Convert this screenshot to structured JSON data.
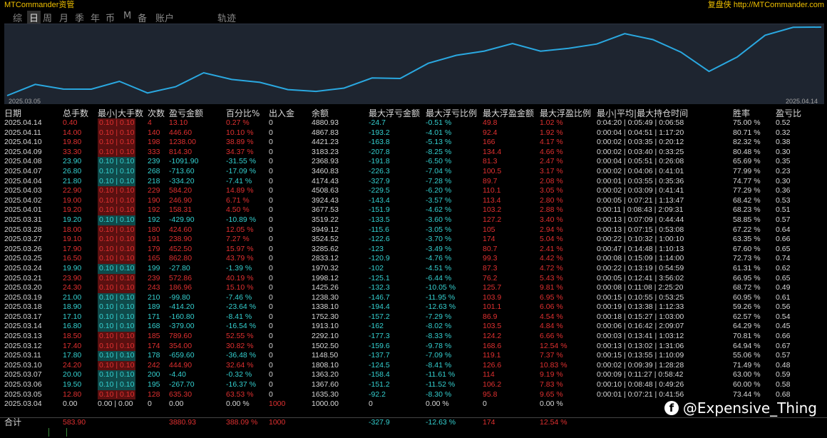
{
  "app": {
    "title": "MTCommander资管",
    "site": "复盘侠 http://MTCommander.com"
  },
  "tabs": [
    "综",
    "日",
    "周",
    "月",
    "季",
    "年",
    "币",
    "M",
    "备",
    "账户",
    "轨迹"
  ],
  "active_tab": "日",
  "equity_chart": {
    "start_date": "2025.03.05",
    "end_date": "2025.04.14",
    "line_color": "#2aa8e0",
    "background": "#1e2530",
    "balance_series": [
      1000.0,
      1635.3,
      1367.6,
      1363.2,
      1808.1,
      1148.5,
      1502.5,
      2292.1,
      1913.1,
      1752.3,
      1338.1,
      1238.3,
      1425.26,
      1998.12,
      1970.32,
      2833.12,
      3285.62,
      3524.52,
      3949.12,
      3519.22,
      3677.53,
      3924.43,
      4508.63,
      4174.43,
      3460.83,
      2368.93,
      3183.23,
      4421.23,
      4867.83,
      4880.93
    ]
  },
  "headers": [
    "日期",
    "总手数",
    "最小|大手数",
    "次数",
    "盈亏金额",
    "百分比%",
    "出入金",
    "余额",
    "最大浮亏金额",
    "最大浮亏比例",
    "最大浮盈金额",
    "最大浮盈比例",
    "最小|平均|最大持仓时间",
    "胜率",
    "盈亏比"
  ],
  "rows": [
    {
      "date": "2025.04.14",
      "lots": "0.40",
      "minmax": "0.10 | 0.10",
      "count": "4",
      "pnl": "13.10",
      "pct": "0.27 %",
      "io": "0",
      "bal": "4880.93",
      "fl": "-24.7",
      "flp": "-0.51 %",
      "fp": "49.8",
      "fpp": "1.02 %",
      "hold": "0:04:20 | 0:05:49 | 0:06:58",
      "win": "75.00 %",
      "pr": "0.52",
      "s": "p"
    },
    {
      "date": "2025.04.11",
      "lots": "14.00",
      "minmax": "0.10 | 0.10",
      "count": "140",
      "pnl": "446.60",
      "pct": "10.10 %",
      "io": "0",
      "bal": "4867.83",
      "fl": "-193.2",
      "flp": "-4.01 %",
      "fp": "92.4",
      "fpp": "1.92 %",
      "hold": "0:00:04 | 0:04:51 | 1:17:20",
      "win": "80.71 %",
      "pr": "0.32",
      "s": "p"
    },
    {
      "date": "2025.04.10",
      "lots": "19.80",
      "minmax": "0.10 | 0.10",
      "count": "198",
      "pnl": "1238.00",
      "pct": "38.89 %",
      "io": "0",
      "bal": "4421.23",
      "fl": "-163.8",
      "flp": "-5.13 %",
      "fp": "166",
      "fpp": "4.17 %",
      "hold": "0:00:02 | 0:03:35 | 0:20:12",
      "win": "82.32 %",
      "pr": "0.38",
      "s": "p"
    },
    {
      "date": "2025.04.09",
      "lots": "33.30",
      "minmax": "0.10 | 0.10",
      "count": "333",
      "pnl": "814.30",
      "pct": "34.37 %",
      "io": "0",
      "bal": "3183.23",
      "fl": "-207.8",
      "flp": "-8.25 %",
      "fp": "134.4",
      "fpp": "4.66 %",
      "hold": "0:00:02 | 0:03:40 | 0:33:25",
      "win": "80.48 %",
      "pr": "0.30",
      "s": "p"
    },
    {
      "date": "2025.04.08",
      "lots": "23.90",
      "minmax": "0.10 | 0.10",
      "count": "239",
      "pnl": "-1091.90",
      "pct": "-31.55 %",
      "io": "0",
      "bal": "2368.93",
      "fl": "-191.8",
      "flp": "-6.50 %",
      "fp": "81.3",
      "fpp": "2.47 %",
      "hold": "0:00:04 | 0:05:51 | 0:26:08",
      "win": "65.69 %",
      "pr": "0.35",
      "s": "n"
    },
    {
      "date": "2025.04.07",
      "lots": "26.80",
      "minmax": "0.10 | 0.10",
      "count": "268",
      "pnl": "-713.60",
      "pct": "-17.09 %",
      "io": "0",
      "bal": "3460.83",
      "fl": "-226.3",
      "flp": "-7.04 %",
      "fp": "100.5",
      "fpp": "3.17 %",
      "hold": "0:00:02 | 0:04:06 | 0:41:01",
      "win": "77.99 %",
      "pr": "0.23",
      "s": "n"
    },
    {
      "date": "2025.04.04",
      "lots": "21.80",
      "minmax": "0.10 | 0.10",
      "count": "218",
      "pnl": "-334.20",
      "pct": "-7.41 %",
      "io": "0",
      "bal": "4174.43",
      "fl": "-327.9",
      "flp": "-7.28 %",
      "fp": "89.7",
      "fpp": "2.08 %",
      "hold": "0:00:01 | 0:03:55 | 0:35:36",
      "win": "74.77 %",
      "pr": "0.30",
      "s": "n"
    },
    {
      "date": "2025.04.03",
      "lots": "22.90",
      "minmax": "0.10 | 0.10",
      "count": "229",
      "pnl": "584.20",
      "pct": "14.89 %",
      "io": "0",
      "bal": "4508.63",
      "fl": "-229.5",
      "flp": "-6.20 %",
      "fp": "110.1",
      "fpp": "3.05 %",
      "hold": "0:00:02 | 0:03:09 | 0:41:41",
      "win": "77.29 %",
      "pr": "0.36",
      "s": "p"
    },
    {
      "date": "2025.04.02",
      "lots": "19.00",
      "minmax": "0.10 | 0.10",
      "count": "190",
      "pnl": "246.90",
      "pct": "6.71 %",
      "io": "0",
      "bal": "3924.43",
      "fl": "-143.4",
      "flp": "-3.57 %",
      "fp": "113.4",
      "fpp": "2.80 %",
      "hold": "0:00:05 | 0:07:21 | 1:13:47",
      "win": "68.42 %",
      "pr": "0.53",
      "s": "p"
    },
    {
      "date": "2025.04.01",
      "lots": "19.20",
      "minmax": "0.10 | 0.10",
      "count": "192",
      "pnl": "158.31",
      "pct": "4.50 %",
      "io": "0",
      "bal": "3677.53",
      "fl": "-151.9",
      "flp": "-4.62 %",
      "fp": "103.2",
      "fpp": "2.88 %",
      "hold": "0:00:11 | 0:08:43 | 2:09:31",
      "win": "68.23 %",
      "pr": "0.51",
      "s": "p"
    },
    {
      "date": "2025.03.31",
      "lots": "19.20",
      "minmax": "0.10 | 0.10",
      "count": "192",
      "pnl": "-429.90",
      "pct": "-10.89 %",
      "io": "0",
      "bal": "3519.22",
      "fl": "-133.5",
      "flp": "-3.60 %",
      "fp": "127.2",
      "fpp": "3.40 %",
      "hold": "0:00:13 | 0:07:09 | 0:44:44",
      "win": "58.85 %",
      "pr": "0.57",
      "s": "n"
    },
    {
      "date": "2025.03.28",
      "lots": "18.00",
      "minmax": "0.10 | 0.10",
      "count": "180",
      "pnl": "424.60",
      "pct": "12.05 %",
      "io": "0",
      "bal": "3949.12",
      "fl": "-115.6",
      "flp": "-3.05 %",
      "fp": "105",
      "fpp": "2.94 %",
      "hold": "0:00:13 | 0:07:15 | 0:53:08",
      "win": "67.22 %",
      "pr": "0.64",
      "s": "p"
    },
    {
      "date": "2025.03.27",
      "lots": "19.10",
      "minmax": "0.10 | 0.10",
      "count": "191",
      "pnl": "238.90",
      "pct": "7.27 %",
      "io": "0",
      "bal": "3524.52",
      "fl": "-122.6",
      "flp": "-3.70 %",
      "fp": "174",
      "fpp": "5.04 %",
      "hold": "0:00:22 | 0:10:32 | 1:00:10",
      "win": "63.35 %",
      "pr": "0.66",
      "s": "p"
    },
    {
      "date": "2025.03.26",
      "lots": "17.90",
      "minmax": "0.10 | 0.10",
      "count": "179",
      "pnl": "452.50",
      "pct": "15.97 %",
      "io": "0",
      "bal": "3285.62",
      "fl": "-123",
      "flp": "-3.49 %",
      "fp": "80.7",
      "fpp": "2.41 %",
      "hold": "0:00:47 | 0:14:48 | 1:10:13",
      "win": "67.60 %",
      "pr": "0.65",
      "s": "p"
    },
    {
      "date": "2025.03.25",
      "lots": "16.50",
      "minmax": "0.10 | 0.10",
      "count": "165",
      "pnl": "862.80",
      "pct": "43.79 %",
      "io": "0",
      "bal": "2833.12",
      "fl": "-120.9",
      "flp": "-4.76 %",
      "fp": "99.3",
      "fpp": "4.42 %",
      "hold": "0:00:08 | 0:15:09 | 1:14:00",
      "win": "72.73 %",
      "pr": "0.74",
      "s": "p"
    },
    {
      "date": "2025.03.24",
      "lots": "19.90",
      "minmax": "0.10 | 0.10",
      "count": "199",
      "pnl": "-27.80",
      "pct": "-1.39 %",
      "io": "0",
      "bal": "1970.32",
      "fl": "-102",
      "flp": "-4.51 %",
      "fp": "87.3",
      "fpp": "4.72 %",
      "hold": "0:00:22 | 0:13:19 | 0:54:59",
      "win": "61.31 %",
      "pr": "0.62",
      "s": "n"
    },
    {
      "date": "2025.03.21",
      "lots": "23.90",
      "minmax": "0.10 | 0.10",
      "count": "239",
      "pnl": "572.86",
      "pct": "40.19 %",
      "io": "0",
      "bal": "1998.12",
      "fl": "-125.1",
      "flp": "-6.44 %",
      "fp": "76.2",
      "fpp": "5.43 %",
      "hold": "0:00:05 | 0:12:41 | 3:56:02",
      "win": "66.95 %",
      "pr": "0.65",
      "s": "p"
    },
    {
      "date": "2025.03.20",
      "lots": "24.30",
      "minmax": "0.10 | 0.10",
      "count": "243",
      "pnl": "186.96",
      "pct": "15.10 %",
      "io": "0",
      "bal": "1425.26",
      "fl": "-132.3",
      "flp": "-10.05 %",
      "fp": "125.7",
      "fpp": "9.81 %",
      "hold": "0:00:08 | 0:11:08 | 2:25:20",
      "win": "68.72 %",
      "pr": "0.49",
      "s": "p"
    },
    {
      "date": "2025.03.19",
      "lots": "21.00",
      "minmax": "0.10 | 0.10",
      "count": "210",
      "pnl": "-99.80",
      "pct": "-7.46 %",
      "io": "0",
      "bal": "1238.30",
      "fl": "-146.7",
      "flp": "-11.95 %",
      "fp": "103.9",
      "fpp": "6.95 %",
      "hold": "0:00:15 | 0:10:55 | 0:53:25",
      "win": "60.95 %",
      "pr": "0.61",
      "s": "n"
    },
    {
      "date": "2025.03.18",
      "lots": "18.90",
      "minmax": "0.10 | 0.10",
      "count": "189",
      "pnl": "-414.20",
      "pct": "-23.64 %",
      "io": "0",
      "bal": "1338.10",
      "fl": "-194.4",
      "flp": "-12.63 %",
      "fp": "101.1",
      "fpp": "6.06 %",
      "hold": "0:00:19 | 0:13:38 | 1:12:33",
      "win": "59.26 %",
      "pr": "0.56",
      "s": "n"
    },
    {
      "date": "2025.03.17",
      "lots": "17.10",
      "minmax": "0.10 | 0.10",
      "count": "171",
      "pnl": "-160.80",
      "pct": "-8.41 %",
      "io": "0",
      "bal": "1752.30",
      "fl": "-157.2",
      "flp": "-7.29 %",
      "fp": "86.9",
      "fpp": "4.54 %",
      "hold": "0:00:18 | 0:15:27 | 1:03:00",
      "win": "62.57 %",
      "pr": "0.54",
      "s": "n"
    },
    {
      "date": "2025.03.14",
      "lots": "16.80",
      "minmax": "0.10 | 0.10",
      "count": "168",
      "pnl": "-379.00",
      "pct": "-16.54 %",
      "io": "0",
      "bal": "1913.10",
      "fl": "-162",
      "flp": "-8.02 %",
      "fp": "103.5",
      "fpp": "4.84 %",
      "hold": "0:00:06 | 0:16:42 | 2:09:07",
      "win": "64.29 %",
      "pr": "0.45",
      "s": "n"
    },
    {
      "date": "2025.03.13",
      "lots": "18.50",
      "minmax": "0.10 | 0.10",
      "count": "185",
      "pnl": "789.60",
      "pct": "52.55 %",
      "io": "0",
      "bal": "2292.10",
      "fl": "-177.3",
      "flp": "-8.33 %",
      "fp": "124.2",
      "fpp": "6.66 %",
      "hold": "0:00:03 | 0:13:41 | 1:03:12",
      "win": "70.81 %",
      "pr": "0.66",
      "s": "p"
    },
    {
      "date": "2025.03.12",
      "lots": "17.40",
      "minmax": "0.10 | 0.10",
      "count": "174",
      "pnl": "354.00",
      "pct": "30.82 %",
      "io": "0",
      "bal": "1502.50",
      "fl": "-159.6",
      "flp": "-9.78 %",
      "fp": "168.6",
      "fpp": "12.54 %",
      "hold": "0:00:13 | 0:13:02 | 1:31:06",
      "win": "64.94 %",
      "pr": "0.67",
      "s": "p"
    },
    {
      "date": "2025.03.11",
      "lots": "17.80",
      "minmax": "0.10 | 0.10",
      "count": "178",
      "pnl": "-659.60",
      "pct": "-36.48 %",
      "io": "0",
      "bal": "1148.50",
      "fl": "-137.7",
      "flp": "-7.09 %",
      "fp": "119.1",
      "fpp": "7.37 %",
      "hold": "0:00:15 | 0:13:55 | 1:10:09",
      "win": "55.06 %",
      "pr": "0.57",
      "s": "n"
    },
    {
      "date": "2025.03.10",
      "lots": "24.20",
      "minmax": "0.10 | 0.10",
      "count": "242",
      "pnl": "444.90",
      "pct": "32.64 %",
      "io": "0",
      "bal": "1808.10",
      "fl": "-124.5",
      "flp": "-8.41 %",
      "fp": "126.6",
      "fpp": "10.83 %",
      "hold": "0:00:02 | 0:09:39 | 1:28:28",
      "win": "71.49 %",
      "pr": "0.48",
      "s": "p"
    },
    {
      "date": "2025.03.07",
      "lots": "20.00",
      "minmax": "0.10 | 0.10",
      "count": "200",
      "pnl": "-4.40",
      "pct": "-0.32 %",
      "io": "0",
      "bal": "1363.20",
      "fl": "-158.4",
      "flp": "-11.61 %",
      "fp": "114",
      "fpp": "9.19 %",
      "hold": "0:00:09 | 0:11:27 | 0:58:42",
      "win": "63.00 %",
      "pr": "0.59",
      "s": "n"
    },
    {
      "date": "2025.03.06",
      "lots": "19.50",
      "minmax": "0.10 | 0.10",
      "count": "195",
      "pnl": "-267.70",
      "pct": "-16.37 %",
      "io": "0",
      "bal": "1367.60",
      "fl": "-151.2",
      "flp": "-11.52 %",
      "fp": "106.2",
      "fpp": "7.83 %",
      "hold": "0:00:10 | 0:08:48 | 0:49:26",
      "win": "60.00 %",
      "pr": "0.58",
      "s": "n"
    },
    {
      "date": "2025.03.05",
      "lots": "12.80",
      "minmax": "0.10 | 0.10",
      "count": "128",
      "pnl": "635.30",
      "pct": "63.53 %",
      "io": "0",
      "bal": "1635.30",
      "fl": "-92.2",
      "flp": "-8.30 %",
      "fp": "95.8",
      "fpp": "9.65 %",
      "hold": "0:00:01 | 0:07:21 | 0:41:56",
      "win": "73.44 %",
      "pr": "0.68",
      "s": "p"
    },
    {
      "date": "2025.03.04",
      "lots": "0.00",
      "minmax": "0.00 | 0.00",
      "count": "0",
      "pnl": "0.00",
      "pct": "0.00 %",
      "io": "1000",
      "bal": "1000.00",
      "fl": "0",
      "flp": "0.00 %",
      "fp": "0",
      "fpp": "0.00 %",
      "hold": "",
      "win": "",
      "pr": "",
      "s": "z"
    }
  ],
  "total": {
    "label": "合计",
    "lots": "583.90",
    "pnl": "3880.93",
    "pct": "388.09 %",
    "io": "1000",
    "fl": "-327.9",
    "flp": "-12.63 %",
    "fp": "174",
    "fpp": "12.54 %"
  },
  "watermark": {
    "icon": "f",
    "text": "@Expensive_Thing"
  }
}
